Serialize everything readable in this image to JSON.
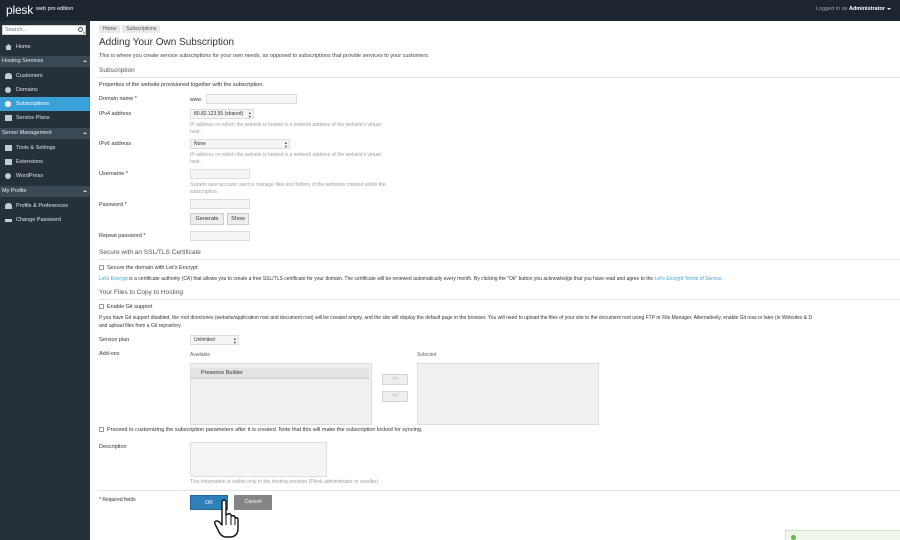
{
  "app": {
    "logo": "plesk",
    "edition": "web pro edition"
  },
  "user": {
    "prefix": "Logged in as",
    "name": "Administrator"
  },
  "sidebar": {
    "search_placeholder": "Search...",
    "groups": [
      {
        "label": "Hosting Services",
        "items": [
          {
            "label": "Customers",
            "icon": "customers-icon"
          },
          {
            "label": "Domains",
            "icon": "globe-icon"
          },
          {
            "label": "Subscriptions",
            "icon": "subscriptions-icon",
            "active": true
          },
          {
            "label": "Service Plans",
            "icon": "service-plans-icon"
          }
        ]
      },
      {
        "label": "Server Management",
        "items": [
          {
            "label": "Tools & Settings",
            "icon": "tools-icon"
          },
          {
            "label": "Extensions",
            "icon": "extensions-icon"
          },
          {
            "label": "WordPress",
            "icon": "wordpress-icon"
          }
        ]
      },
      {
        "label": "My Profile",
        "items": [
          {
            "label": "Profile & Preferences",
            "icon": "profile-icon"
          },
          {
            "label": "Change Password",
            "icon": "key-icon"
          }
        ]
      }
    ],
    "home": "Home"
  },
  "breadcrumbs": [
    "Home",
    "Subscriptions"
  ],
  "page": {
    "title": "Adding Your Own Subscription",
    "intro": "This is where you create service subscriptions for your own needs, as opposed to subscriptions that provide services to your customers."
  },
  "subscription": {
    "section_title": "Subscription",
    "desc": "Properties of the website provisioned together with the subscription.",
    "domain_label": "Domain name *",
    "domain_prefix": "www.",
    "domain_value": "",
    "ipv4_label": "IPv4 address",
    "ipv4_value": "80.82.123.55 (shared)",
    "ipv4_hint": "IP address on which the website is hosted is a network address of the website's virtual host.",
    "ipv6_label": "IPv6 address",
    "ipv6_value": "None",
    "ipv6_hint": "IP address on which the website is hosted is a network address of the website's virtual host.",
    "username_label": "Username *",
    "username_hint": "System user account used to manage files and folders of the websites created within the subscription.",
    "password_label": "Password *",
    "generate_label": "Generate",
    "show_label": "Show",
    "repeat_label": "Repeat password *"
  },
  "ssl": {
    "section_title": "Secure with an SSL/TLS Certificate",
    "checkbox_label": "Secure the domain with Let's Encrypt",
    "note_link": "Let's Encrypt",
    "note_text": " is a certificate authority (CA) that allows you to create a free SSL/TLS certificate for your domain. The certificate will be renewed automatically every month. By clicking the \"Ok\" button you acknowledge that you have read and agree to the ",
    "terms_link": "Let's Encrypt Terms of Service."
  },
  "files": {
    "section_title": "Your Files to Copy to Hosting",
    "git_label": "Enable Git support",
    "git_note_line1": "If you have Git support disabled, the root directories (website/application root and document root) will be created empty, and the site will display the default page in the browser. You will need to upload the files of your site to the document root using FTP or File Manager. Alternatively, enable Git now or later (in Websites & D",
    "git_note_line2": "and upload files from a Git repository."
  },
  "plan": {
    "label": "Service plan",
    "value": "Unlimited",
    "addons_label": "Add-ons",
    "available_label": "Available",
    "selected_label": "Selected",
    "available_items": [
      "Presence Builder"
    ],
    "add_btn": ">>",
    "remove_btn": "<<",
    "proceed_label": "Proceed to customizing the subscription parameters after it is created. Note that this will make the subscription locked for syncing.",
    "description_label": "Description",
    "description_hint": "This information is visible only to the hosting provider (Plesk administrator or reseller)."
  },
  "footer": {
    "required_note": "* Required fields",
    "ok_label": "OK",
    "cancel_label": "Cancel"
  },
  "colors": {
    "accent": "#3aa1d6",
    "topbar": "#1d2531",
    "sidebar": "#263038",
    "ok_button": "#2f7fb8"
  }
}
